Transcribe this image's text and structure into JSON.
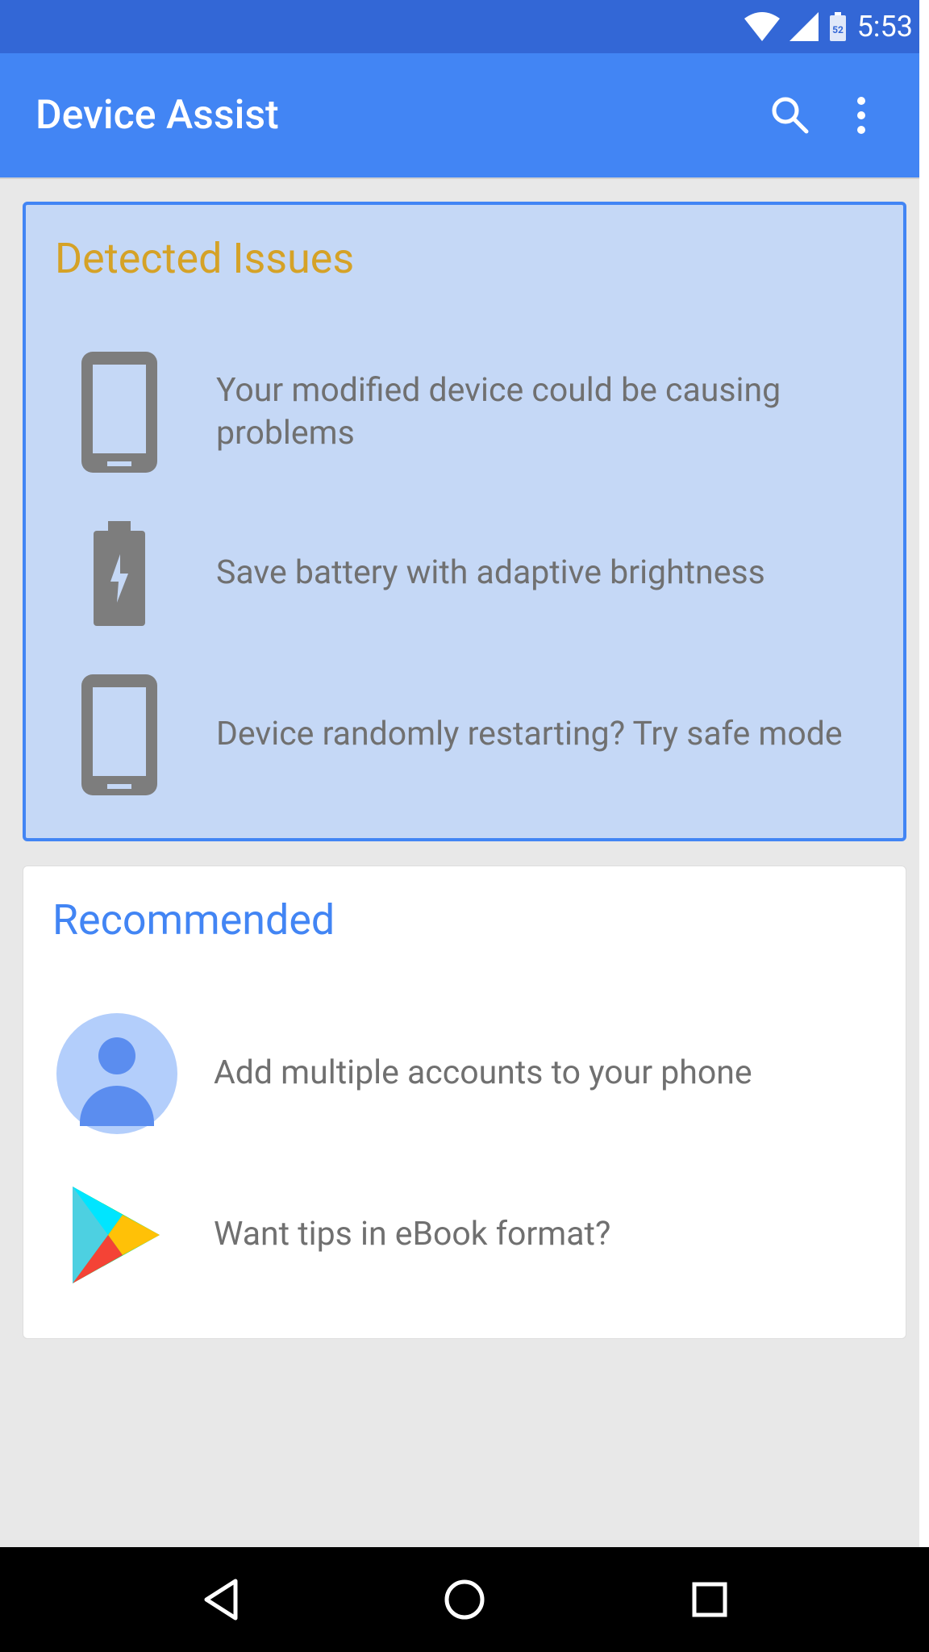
{
  "status": {
    "time": "5:53",
    "battery_level": "52"
  },
  "appbar": {
    "title": "Device Assist"
  },
  "detected": {
    "title": "Detected Issues",
    "items": [
      {
        "text": "Your modified device could be causing problems"
      },
      {
        "text": "Save battery with adaptive brightness"
      },
      {
        "text": "Device randomly restarting? Try safe mode"
      }
    ]
  },
  "recommended": {
    "title": "Recommended",
    "items": [
      {
        "text": "Add multiple accounts to your phone"
      },
      {
        "text": "Want tips in eBook format?"
      }
    ]
  }
}
